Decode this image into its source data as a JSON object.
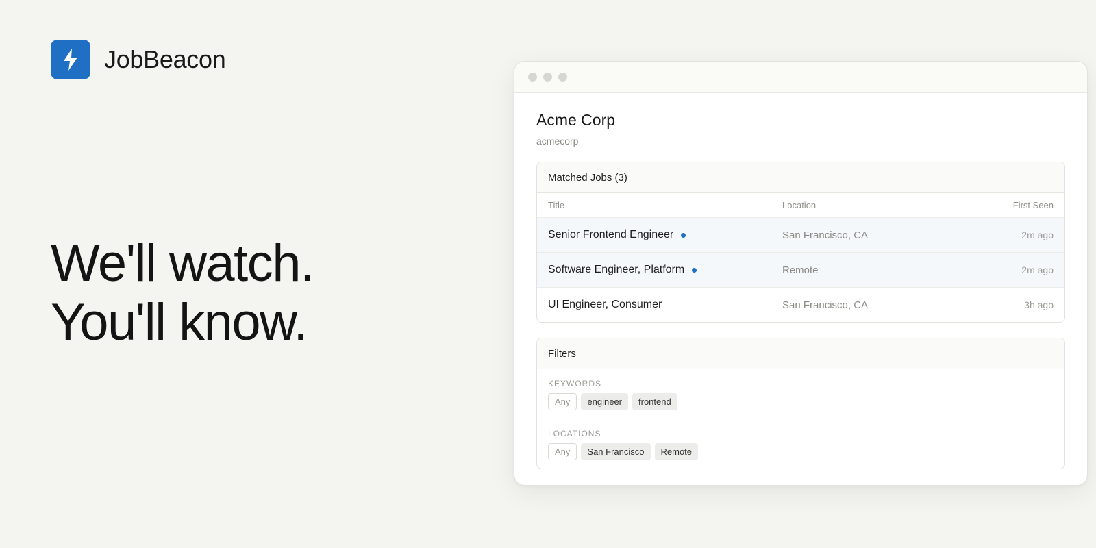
{
  "brand": {
    "name": "JobBeacon",
    "icon": "lightning-bolt-icon",
    "accent": "#1f6fc5"
  },
  "hero": {
    "line1": "We'll watch.",
    "line2": "You'll know."
  },
  "window": {
    "company": {
      "name": "Acme Corp",
      "slug": "acmecorp"
    },
    "matched_jobs": {
      "header": "Matched Jobs (3)",
      "columns": {
        "title": "Title",
        "location": "Location",
        "first_seen": "First Seen"
      },
      "rows": [
        {
          "title": "Senior Frontend Engineer",
          "location": "San Francisco, CA",
          "first_seen": "2m ago",
          "is_new": true
        },
        {
          "title": "Software Engineer, Platform",
          "location": "Remote",
          "first_seen": "2m ago",
          "is_new": true
        },
        {
          "title": "UI Engineer, Consumer",
          "location": "San Francisco, CA",
          "first_seen": "3h ago",
          "is_new": false
        }
      ]
    },
    "filters": {
      "header": "Filters",
      "keywords": {
        "label": "KEYWORDS",
        "any_label": "Any",
        "chips": [
          "engineer",
          "frontend"
        ]
      },
      "locations": {
        "label": "LOCATIONS",
        "any_label": "Any",
        "chips": [
          "San Francisco",
          "Remote"
        ]
      }
    }
  }
}
